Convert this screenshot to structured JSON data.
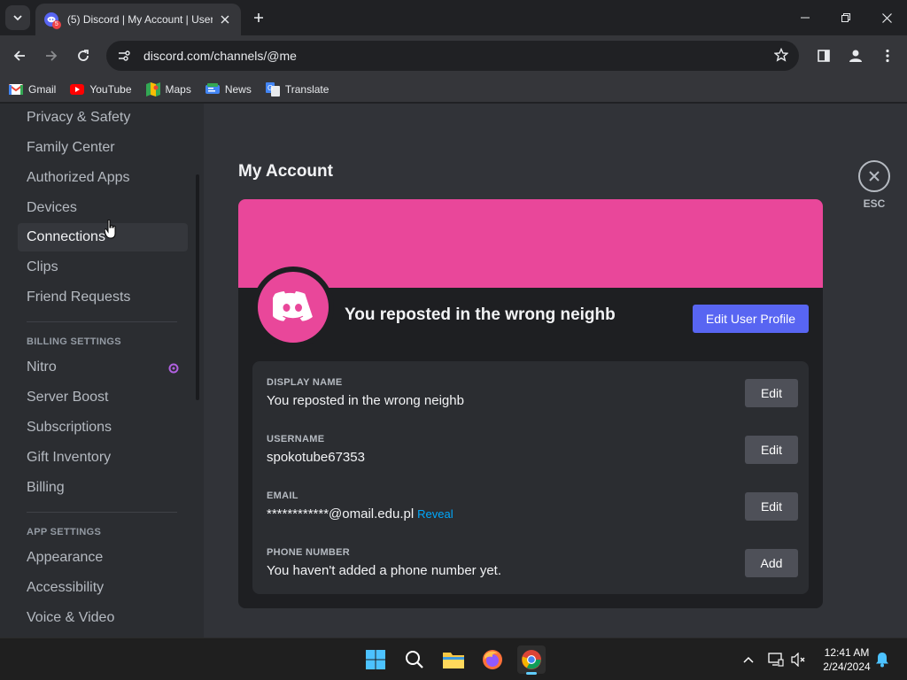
{
  "browser": {
    "tab_title": "(5) Discord | My Account | User Settings",
    "tab_badge": "5",
    "url_host": "discord.com",
    "url_path": "/channels/@me",
    "bookmarks": [
      {
        "label": "Gmail",
        "icon": "gmail-icon"
      },
      {
        "label": "YouTube",
        "icon": "youtube-icon"
      },
      {
        "label": "Maps",
        "icon": "maps-icon"
      },
      {
        "label": "News",
        "icon": "news-icon"
      },
      {
        "label": "Translate",
        "icon": "translate-icon"
      }
    ]
  },
  "sidebar": {
    "user_items": [
      "Privacy & Safety",
      "Family Center",
      "Authorized Apps",
      "Devices",
      "Connections",
      "Clips",
      "Friend Requests"
    ],
    "billing_header": "BILLING SETTINGS",
    "billing_items": [
      "Nitro",
      "Server Boost",
      "Subscriptions",
      "Gift Inventory",
      "Billing"
    ],
    "app_header": "APP SETTINGS",
    "app_items": [
      "Appearance",
      "Accessibility",
      "Voice & Video"
    ],
    "active_item": "Connections"
  },
  "account": {
    "page_title": "My Account",
    "esc_label": "ESC",
    "display_name_header": "You reposted in the wrong neighb",
    "edit_profile_label": "Edit User Profile",
    "banner_color": "#e9479a",
    "fields": [
      {
        "label": "DISPLAY NAME",
        "value": "You reposted in the wrong neighb",
        "button": "Edit"
      },
      {
        "label": "USERNAME",
        "value": "spokotube67353",
        "button": "Edit"
      },
      {
        "label": "EMAIL",
        "value": "************@omail.edu.pl",
        "extra": "Reveal",
        "button": "Edit"
      },
      {
        "label": "PHONE NUMBER",
        "value": "You haven't added a phone number yet.",
        "button": "Add"
      }
    ]
  },
  "taskbar": {
    "time": "12:41 AM",
    "date": "2/24/2024"
  }
}
